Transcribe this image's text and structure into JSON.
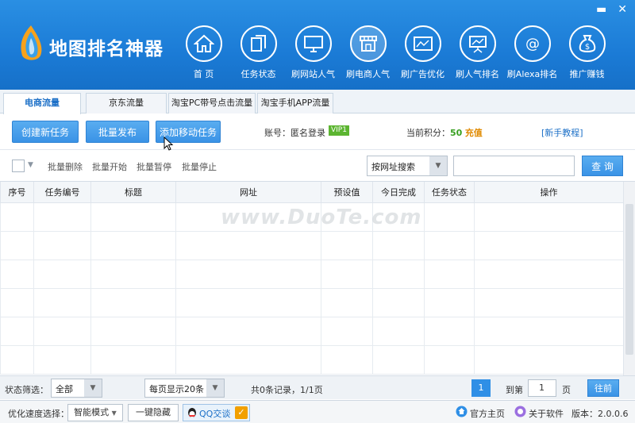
{
  "app": {
    "title": "地图排名神器"
  },
  "window": {
    "minimize": "▬",
    "close": "✕"
  },
  "nav": [
    {
      "label": "首 页",
      "icon": "home-icon"
    },
    {
      "label": "任务状态",
      "icon": "documents-icon"
    },
    {
      "label": "刷网站人气",
      "icon": "monitor-icon"
    },
    {
      "label": "刷电商人气",
      "icon": "store-icon",
      "active": true
    },
    {
      "label": "刷广告优化",
      "icon": "ad-icon"
    },
    {
      "label": "刷人气排名",
      "icon": "chart-board-icon"
    },
    {
      "label": "刷Alexa排名",
      "icon": "at-icon"
    },
    {
      "label": "推广赚钱",
      "icon": "money-bag-icon"
    }
  ],
  "tabs": [
    "电商流量",
    "京东流量",
    "淘宝PC带号点击流量",
    "淘宝手机APP流量"
  ],
  "actions": {
    "create": "创建新任务",
    "batch_publish": "批量发布",
    "add_mobile": "添加移动任务",
    "account_label": "账号：匿名登录",
    "vip": "VIP1",
    "points_label": "当前积分：",
    "points": "50",
    "recharge": "充值",
    "tutorial": "[新手教程]"
  },
  "filter": {
    "batch_delete": "批量删除",
    "batch_start": "批量开始",
    "batch_pause": "批量暂停",
    "batch_stop": "批量停止",
    "search_by": "按网址搜索",
    "search_value": "",
    "query": "查 询"
  },
  "table": {
    "columns": [
      "序号",
      "任务编号",
      "标题",
      "网址",
      "预设值",
      "今日完成",
      "任务状态",
      "操作"
    ],
    "rows": []
  },
  "watermark": "www.DuoTe.com",
  "pagination": {
    "filter_label": "状态筛选：",
    "filter_value": "全部",
    "per_page": "每页显示20条",
    "summary": "共0条记录，1/1页",
    "current_page": "1",
    "goto_label": "到第",
    "goto_value": "1",
    "page_unit": "页",
    "go": "往前"
  },
  "status": {
    "speed_label": "优化速度选择：",
    "speed_mode": "智能模式",
    "hide": "一键隐藏",
    "qq": "QQ交谈",
    "official": "官方主页",
    "about": "关于软件",
    "version": "版本：2.0.0.6"
  },
  "colors": {
    "header": "#1b7bd6",
    "accent": "#3a93e6",
    "vip": "#5cb531",
    "points": "#38a021"
  }
}
